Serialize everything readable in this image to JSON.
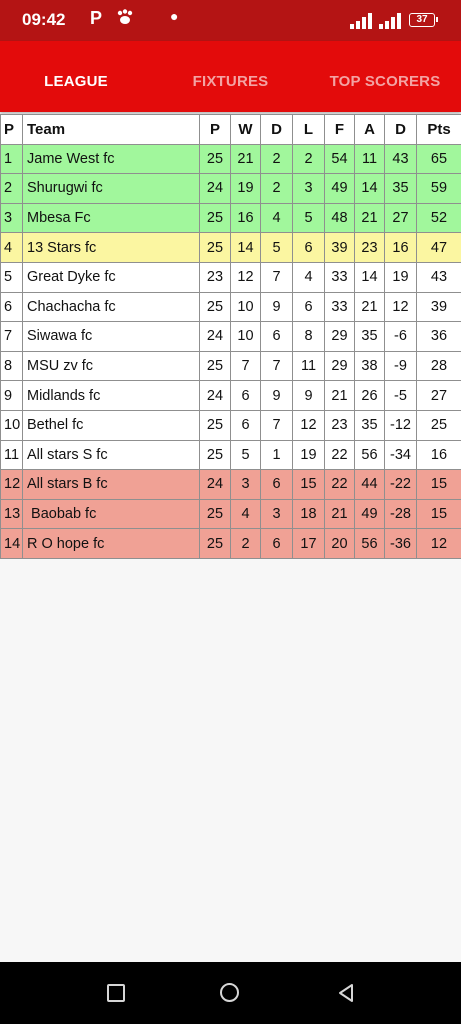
{
  "status_bar": {
    "time": "09:42",
    "notification_icons": [
      "P",
      "paw"
    ],
    "battery": "37"
  },
  "tabs": [
    {
      "label": "LEAGUE",
      "active": true
    },
    {
      "label": "FIXTURES",
      "active": false
    },
    {
      "label": "TOP SCORERS",
      "active": false
    }
  ],
  "table": {
    "headers": [
      "P",
      "Team",
      "P",
      "W",
      "D",
      "L",
      "F",
      "A",
      "D",
      "Pts"
    ],
    "rows": [
      {
        "zone": "top",
        "cells": [
          "1",
          "Jame West fc",
          "25",
          "21",
          "2",
          "2",
          "54",
          "11",
          "43",
          "65"
        ]
      },
      {
        "zone": "top",
        "cells": [
          "2",
          "Shurugwi fc",
          "24",
          "19",
          "2",
          "3",
          "49",
          "14",
          "35",
          "59"
        ]
      },
      {
        "zone": "top",
        "cells": [
          "3",
          "Mbesa Fc",
          "25",
          "16",
          "4",
          "5",
          "48",
          "21",
          "27",
          "52"
        ]
      },
      {
        "zone": "mid",
        "cells": [
          "4",
          "13 Stars fc",
          "25",
          "14",
          "5",
          "6",
          "39",
          "23",
          "16",
          "47"
        ]
      },
      {
        "zone": "none",
        "cells": [
          "5",
          "Great Dyke fc",
          "23",
          "12",
          "7",
          "4",
          "33",
          "14",
          "19",
          "43"
        ]
      },
      {
        "zone": "none",
        "cells": [
          "6",
          "Chachacha fc",
          "25",
          "10",
          "9",
          "6",
          "33",
          "21",
          "12",
          "39"
        ]
      },
      {
        "zone": "none",
        "cells": [
          "7",
          "Siwawa fc",
          "24",
          "10",
          "6",
          "8",
          "29",
          "35",
          "-6",
          "36"
        ]
      },
      {
        "zone": "none",
        "cells": [
          "8",
          "MSU zv fc",
          "25",
          "7",
          "7",
          "11",
          "29",
          "38",
          "-9",
          "28"
        ]
      },
      {
        "zone": "none",
        "cells": [
          "9",
          "Midlands fc",
          "24",
          "6",
          "9",
          "9",
          "21",
          "26",
          "-5",
          "27"
        ]
      },
      {
        "zone": "none",
        "cells": [
          "10",
          "Bethel fc",
          "25",
          "6",
          "7",
          "12",
          "23",
          "35",
          "-12",
          "25"
        ]
      },
      {
        "zone": "none",
        "cells": [
          "11",
          "All stars S fc",
          "25",
          "5",
          "1",
          "19",
          "22",
          "56",
          "-34",
          "16"
        ]
      },
      {
        "zone": "bottom",
        "cells": [
          "12",
          "All stars B fc",
          "24",
          "3",
          "6",
          "15",
          "22",
          "44",
          "-22",
          "15"
        ]
      },
      {
        "zone": "bottom",
        "cells": [
          "13",
          " Baobab fc",
          "25",
          "4",
          "3",
          "18",
          "21",
          "49",
          "-28",
          "15"
        ]
      },
      {
        "zone": "bottom",
        "cells": [
          "14",
          "R O hope fc",
          "25",
          "2",
          "6",
          "17",
          "20",
          "56",
          "-36",
          "12"
        ]
      }
    ]
  },
  "colors": {
    "status_bar": "#b41414",
    "tab_bar": "#e30b0b",
    "zone_top": "#a1f79c",
    "zone_mid": "#fbf6a1",
    "zone_bottom": "#f0a195"
  },
  "nav_bar": {
    "icons": [
      "recent-apps-icon",
      "home-icon",
      "back-icon"
    ]
  }
}
